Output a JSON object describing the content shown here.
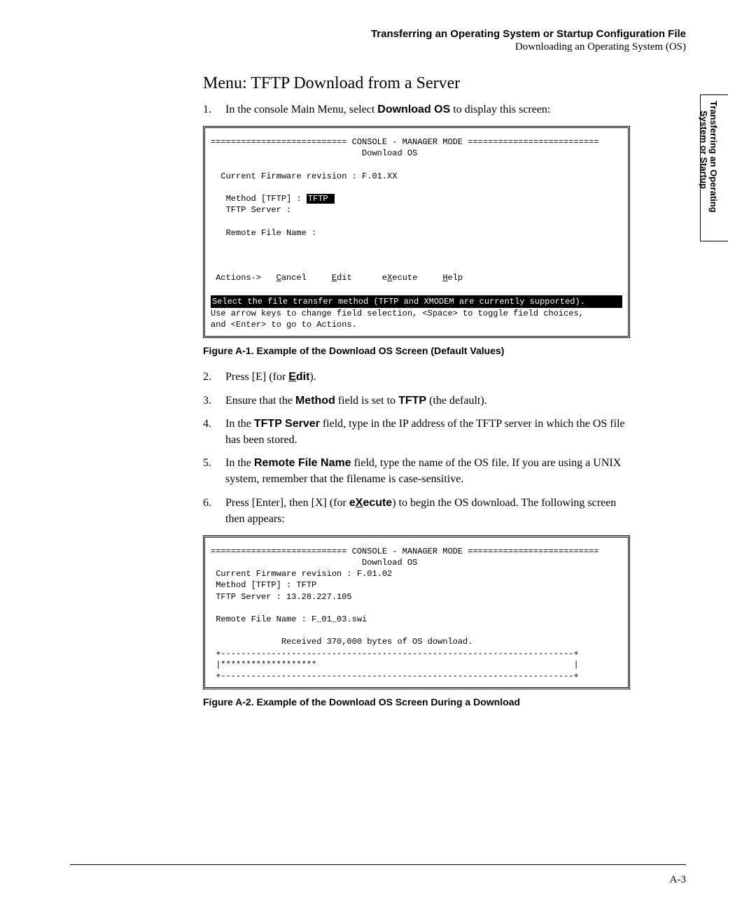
{
  "header": {
    "title": "Transferring an Operating System or Startup Configuration File",
    "subtitle": "Downloading an Operating System (OS)"
  },
  "side_tab": {
    "line1": "Transferring an Operating",
    "line2": "System or Startup"
  },
  "section_title": "Menu: TFTP Download from a Server",
  "steps": {
    "s1": {
      "num": "1.",
      "pre": "In the console Main Menu, select ",
      "bold": "Download OS",
      "post": "  to display this screen:"
    },
    "s2": {
      "num": "2.",
      "pre": "Press [E] (for ",
      "bold_u": "E",
      "bold_rest": "dit",
      "post": ")."
    },
    "s3": {
      "num": "3.",
      "pre": "Ensure that the  ",
      "bold1": "Method",
      "mid": "  field is set to ",
      "bold2": "TFTP",
      "post": " (the default)."
    },
    "s4": {
      "num": "4.",
      "pre": "In the ",
      "bold": "TFTP Server",
      "post": " field, type in the IP address of the TFTP server in which the OS file has been stored."
    },
    "s5": {
      "num": "5.",
      "pre": "In the  ",
      "bold": "Remote File Name",
      "post": "  field, type the name of the OS file. If you are using a UNIX system, remember that the filename is case-sensitive."
    },
    "s6": {
      "num": "6.",
      "pre": "Press [Enter], then [X] (for ",
      "bold_pre": "e",
      "bold_u": "X",
      "bold_rest": "ecute",
      "post": ") to begin the OS download. The following screen then appears:"
    }
  },
  "console1": {
    "header_line": "=========================== CONSOLE - MANAGER MODE ==========================",
    "title": "                              Download OS",
    "firmware": "  Current Firmware revision : F.01.XX",
    "method_label": "   Method [TFTP] : ",
    "method_value": "TFTP ",
    "tftp": "   TFTP Server :",
    "remote": "   Remote File Name :",
    "actions": " Actions->   ",
    "a1": "C",
    "a1r": "ancel",
    "a2": "E",
    "a2r": "dit",
    "a3": "X",
    "a3pre": "e",
    "a3r": "ecute",
    "a4": "H",
    "a4r": "elp",
    "hint1": "Select the file transfer method (TFTP and XMODEM are currently supported).",
    "hint2": "Use arrow keys to change field selection, <Space> to toggle field choices,",
    "hint3": "and <Enter> to go to Actions."
  },
  "figure1_caption": "Figure A-1.    Example of the Download OS Screen (Default Values)",
  "console2": {
    "header_line": "=========================== CONSOLE - MANAGER MODE ==========================",
    "title": "                              Download OS",
    "firmware": " Current Firmware revision : F.01.02",
    "method": " Method [TFTP] : TFTP",
    "tftp": " TFTP Server : 13.28.227.105",
    "remote": " Remote File Name : F_01_03.swi",
    "received": "              Received 370,000 bytes of OS download.",
    "bar_top": " +----------------------------------------------------------------------+",
    "bar_mid": " |*******************                                                   |",
    "bar_bot": " +----------------------------------------------------------------------+"
  },
  "figure2_caption": "Figure A-2.    Example of the Download OS Screen During a Download",
  "page_num": "A-3"
}
